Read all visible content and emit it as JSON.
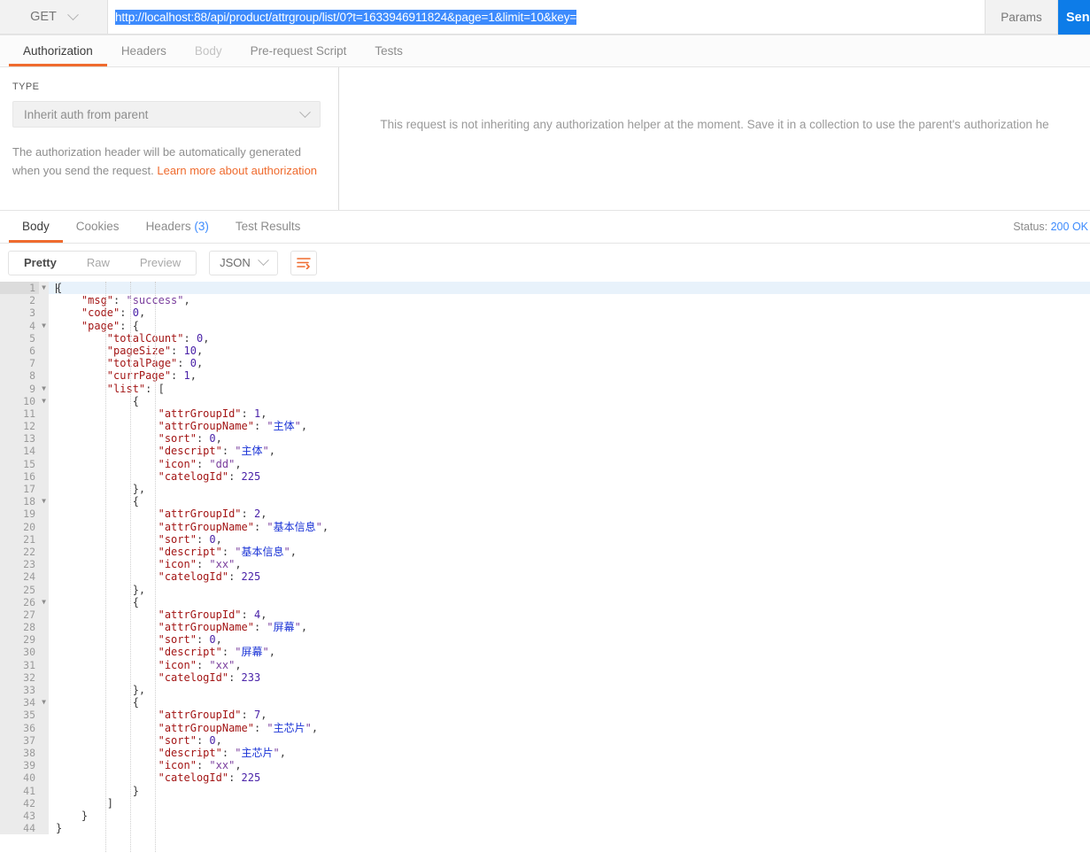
{
  "request": {
    "method": "GET",
    "url": "http://localhost:88/api/product/attrgroup/list/0?t=1633946911824&page=1&limit=10&key=",
    "params_label": "Params",
    "send_label": "Send",
    "tabs": [
      {
        "label": "Authorization",
        "state": "active"
      },
      {
        "label": "Headers",
        "state": "normal"
      },
      {
        "label": "Body",
        "state": "disabled"
      },
      {
        "label": "Pre-request Script",
        "state": "normal"
      },
      {
        "label": "Tests",
        "state": "normal"
      }
    ]
  },
  "auth": {
    "type_label": "TYPE",
    "type_value": "Inherit auth from parent",
    "description": "The authorization header will be automatically generated when you send the request.",
    "link_text": "Learn more about authorization",
    "inherit_message": "This request is not inheriting any authorization helper at the moment. Save it in a collection to use the parent's authorization he"
  },
  "response": {
    "tabs": [
      {
        "label": "Body",
        "state": "active",
        "count": ""
      },
      {
        "label": "Cookies",
        "state": "normal",
        "count": ""
      },
      {
        "label": "Headers",
        "state": "normal",
        "count": "(3)"
      },
      {
        "label": "Test Results",
        "state": "normal",
        "count": ""
      }
    ],
    "status_label": "Status:",
    "status_value": "200 OK",
    "view_modes": [
      {
        "label": "Pretty",
        "state": "active"
      },
      {
        "label": "Raw",
        "state": "normal"
      },
      {
        "label": "Preview",
        "state": "normal"
      }
    ],
    "format": "JSON",
    "wrap_icon": "word-wrap-icon"
  },
  "body_json": {
    "msg": "success",
    "code": 0,
    "page": {
      "totalCount": 0,
      "pageSize": 10,
      "totalPage": 0,
      "currPage": 1,
      "list": [
        {
          "attrGroupId": 1,
          "attrGroupName": "主体",
          "sort": 0,
          "descript": "主体",
          "icon": "dd",
          "catelogId": 225
        },
        {
          "attrGroupId": 2,
          "attrGroupName": "基本信息",
          "sort": 0,
          "descript": "基本信息",
          "icon": "xx",
          "catelogId": 225
        },
        {
          "attrGroupId": 4,
          "attrGroupName": "屏幕",
          "sort": 0,
          "descript": "屏幕",
          "icon": "xx",
          "catelogId": 233
        },
        {
          "attrGroupId": 7,
          "attrGroupName": "主芯片",
          "sort": 0,
          "descript": "主芯片",
          "icon": "xx",
          "catelogId": 225
        }
      ]
    }
  },
  "code_lines": [
    {
      "n": 1,
      "fold": true,
      "indent": 0,
      "tokens": [
        {
          "t": "p",
          "v": "{"
        }
      ],
      "caret": true,
      "highlight": true
    },
    {
      "n": 2,
      "fold": false,
      "indent": 1,
      "tokens": [
        {
          "t": "k",
          "v": "\"msg\""
        },
        {
          "t": "p",
          "v": ": "
        },
        {
          "t": "s",
          "v": "\"success\""
        },
        {
          "t": "p",
          "v": ","
        }
      ]
    },
    {
      "n": 3,
      "fold": false,
      "indent": 1,
      "tokens": [
        {
          "t": "k",
          "v": "\"code\""
        },
        {
          "t": "p",
          "v": ": "
        },
        {
          "t": "n",
          "v": "0"
        },
        {
          "t": "p",
          "v": ","
        }
      ]
    },
    {
      "n": 4,
      "fold": true,
      "indent": 1,
      "tokens": [
        {
          "t": "k",
          "v": "\"page\""
        },
        {
          "t": "p",
          "v": ": {"
        }
      ]
    },
    {
      "n": 5,
      "fold": false,
      "indent": 2,
      "tokens": [
        {
          "t": "k",
          "v": "\"totalCount\""
        },
        {
          "t": "p",
          "v": ": "
        },
        {
          "t": "n",
          "v": "0"
        },
        {
          "t": "p",
          "v": ","
        }
      ]
    },
    {
      "n": 6,
      "fold": false,
      "indent": 2,
      "tokens": [
        {
          "t": "k",
          "v": "\"pageSize\""
        },
        {
          "t": "p",
          "v": ": "
        },
        {
          "t": "n",
          "v": "10"
        },
        {
          "t": "p",
          "v": ","
        }
      ]
    },
    {
      "n": 7,
      "fold": false,
      "indent": 2,
      "tokens": [
        {
          "t": "k",
          "v": "\"totalPage\""
        },
        {
          "t": "p",
          "v": ": "
        },
        {
          "t": "n",
          "v": "0"
        },
        {
          "t": "p",
          "v": ","
        }
      ]
    },
    {
      "n": 8,
      "fold": false,
      "indent": 2,
      "tokens": [
        {
          "t": "k",
          "v": "\"currPage\""
        },
        {
          "t": "p",
          "v": ": "
        },
        {
          "t": "n",
          "v": "1"
        },
        {
          "t": "p",
          "v": ","
        }
      ]
    },
    {
      "n": 9,
      "fold": true,
      "indent": 2,
      "tokens": [
        {
          "t": "k",
          "v": "\"list\""
        },
        {
          "t": "p",
          "v": ": ["
        }
      ]
    },
    {
      "n": 10,
      "fold": true,
      "indent": 3,
      "tokens": [
        {
          "t": "p",
          "v": "{"
        }
      ]
    },
    {
      "n": 11,
      "fold": false,
      "indent": 4,
      "tokens": [
        {
          "t": "k",
          "v": "\"attrGroupId\""
        },
        {
          "t": "p",
          "v": ": "
        },
        {
          "t": "n",
          "v": "1"
        },
        {
          "t": "p",
          "v": ","
        }
      ]
    },
    {
      "n": 12,
      "fold": false,
      "indent": 4,
      "tokens": [
        {
          "t": "k",
          "v": "\"attrGroupName\""
        },
        {
          "t": "p",
          "v": ": "
        },
        {
          "t": "s",
          "v": "\""
        },
        {
          "t": "cn",
          "v": "主体"
        },
        {
          "t": "s",
          "v": "\""
        },
        {
          "t": "p",
          "v": ","
        }
      ]
    },
    {
      "n": 13,
      "fold": false,
      "indent": 4,
      "tokens": [
        {
          "t": "k",
          "v": "\"sort\""
        },
        {
          "t": "p",
          "v": ": "
        },
        {
          "t": "n",
          "v": "0"
        },
        {
          "t": "p",
          "v": ","
        }
      ]
    },
    {
      "n": 14,
      "fold": false,
      "indent": 4,
      "tokens": [
        {
          "t": "k",
          "v": "\"descript\""
        },
        {
          "t": "p",
          "v": ": "
        },
        {
          "t": "s",
          "v": "\""
        },
        {
          "t": "cn",
          "v": "主体"
        },
        {
          "t": "s",
          "v": "\""
        },
        {
          "t": "p",
          "v": ","
        }
      ]
    },
    {
      "n": 15,
      "fold": false,
      "indent": 4,
      "tokens": [
        {
          "t": "k",
          "v": "\"icon\""
        },
        {
          "t": "p",
          "v": ": "
        },
        {
          "t": "s",
          "v": "\"dd\""
        },
        {
          "t": "p",
          "v": ","
        }
      ]
    },
    {
      "n": 16,
      "fold": false,
      "indent": 4,
      "tokens": [
        {
          "t": "k",
          "v": "\"catelogId\""
        },
        {
          "t": "p",
          "v": ": "
        },
        {
          "t": "n",
          "v": "225"
        }
      ]
    },
    {
      "n": 17,
      "fold": false,
      "indent": 3,
      "tokens": [
        {
          "t": "p",
          "v": "},"
        }
      ]
    },
    {
      "n": 18,
      "fold": true,
      "indent": 3,
      "tokens": [
        {
          "t": "p",
          "v": "{"
        }
      ]
    },
    {
      "n": 19,
      "fold": false,
      "indent": 4,
      "tokens": [
        {
          "t": "k",
          "v": "\"attrGroupId\""
        },
        {
          "t": "p",
          "v": ": "
        },
        {
          "t": "n",
          "v": "2"
        },
        {
          "t": "p",
          "v": ","
        }
      ]
    },
    {
      "n": 20,
      "fold": false,
      "indent": 4,
      "tokens": [
        {
          "t": "k",
          "v": "\"attrGroupName\""
        },
        {
          "t": "p",
          "v": ": "
        },
        {
          "t": "s",
          "v": "\""
        },
        {
          "t": "cn",
          "v": "基本信息"
        },
        {
          "t": "s",
          "v": "\""
        },
        {
          "t": "p",
          "v": ","
        }
      ]
    },
    {
      "n": 21,
      "fold": false,
      "indent": 4,
      "tokens": [
        {
          "t": "k",
          "v": "\"sort\""
        },
        {
          "t": "p",
          "v": ": "
        },
        {
          "t": "n",
          "v": "0"
        },
        {
          "t": "p",
          "v": ","
        }
      ]
    },
    {
      "n": 22,
      "fold": false,
      "indent": 4,
      "tokens": [
        {
          "t": "k",
          "v": "\"descript\""
        },
        {
          "t": "p",
          "v": ": "
        },
        {
          "t": "s",
          "v": "\""
        },
        {
          "t": "cn",
          "v": "基本信息"
        },
        {
          "t": "s",
          "v": "\""
        },
        {
          "t": "p",
          "v": ","
        }
      ]
    },
    {
      "n": 23,
      "fold": false,
      "indent": 4,
      "tokens": [
        {
          "t": "k",
          "v": "\"icon\""
        },
        {
          "t": "p",
          "v": ": "
        },
        {
          "t": "s",
          "v": "\"xx\""
        },
        {
          "t": "p",
          "v": ","
        }
      ]
    },
    {
      "n": 24,
      "fold": false,
      "indent": 4,
      "tokens": [
        {
          "t": "k",
          "v": "\"catelogId\""
        },
        {
          "t": "p",
          "v": ": "
        },
        {
          "t": "n",
          "v": "225"
        }
      ]
    },
    {
      "n": 25,
      "fold": false,
      "indent": 3,
      "tokens": [
        {
          "t": "p",
          "v": "},"
        }
      ]
    },
    {
      "n": 26,
      "fold": true,
      "indent": 3,
      "tokens": [
        {
          "t": "p",
          "v": "{"
        }
      ]
    },
    {
      "n": 27,
      "fold": false,
      "indent": 4,
      "tokens": [
        {
          "t": "k",
          "v": "\"attrGroupId\""
        },
        {
          "t": "p",
          "v": ": "
        },
        {
          "t": "n",
          "v": "4"
        },
        {
          "t": "p",
          "v": ","
        }
      ]
    },
    {
      "n": 28,
      "fold": false,
      "indent": 4,
      "tokens": [
        {
          "t": "k",
          "v": "\"attrGroupName\""
        },
        {
          "t": "p",
          "v": ": "
        },
        {
          "t": "s",
          "v": "\""
        },
        {
          "t": "cn",
          "v": "屏幕"
        },
        {
          "t": "s",
          "v": "\""
        },
        {
          "t": "p",
          "v": ","
        }
      ]
    },
    {
      "n": 29,
      "fold": false,
      "indent": 4,
      "tokens": [
        {
          "t": "k",
          "v": "\"sort\""
        },
        {
          "t": "p",
          "v": ": "
        },
        {
          "t": "n",
          "v": "0"
        },
        {
          "t": "p",
          "v": ","
        }
      ]
    },
    {
      "n": 30,
      "fold": false,
      "indent": 4,
      "tokens": [
        {
          "t": "k",
          "v": "\"descript\""
        },
        {
          "t": "p",
          "v": ": "
        },
        {
          "t": "s",
          "v": "\""
        },
        {
          "t": "cn",
          "v": "屏幕"
        },
        {
          "t": "s",
          "v": "\""
        },
        {
          "t": "p",
          "v": ","
        }
      ]
    },
    {
      "n": 31,
      "fold": false,
      "indent": 4,
      "tokens": [
        {
          "t": "k",
          "v": "\"icon\""
        },
        {
          "t": "p",
          "v": ": "
        },
        {
          "t": "s",
          "v": "\"xx\""
        },
        {
          "t": "p",
          "v": ","
        }
      ]
    },
    {
      "n": 32,
      "fold": false,
      "indent": 4,
      "tokens": [
        {
          "t": "k",
          "v": "\"catelogId\""
        },
        {
          "t": "p",
          "v": ": "
        },
        {
          "t": "n",
          "v": "233"
        }
      ]
    },
    {
      "n": 33,
      "fold": false,
      "indent": 3,
      "tokens": [
        {
          "t": "p",
          "v": "},"
        }
      ]
    },
    {
      "n": 34,
      "fold": true,
      "indent": 3,
      "tokens": [
        {
          "t": "p",
          "v": "{"
        }
      ]
    },
    {
      "n": 35,
      "fold": false,
      "indent": 4,
      "tokens": [
        {
          "t": "k",
          "v": "\"attrGroupId\""
        },
        {
          "t": "p",
          "v": ": "
        },
        {
          "t": "n",
          "v": "7"
        },
        {
          "t": "p",
          "v": ","
        }
      ]
    },
    {
      "n": 36,
      "fold": false,
      "indent": 4,
      "tokens": [
        {
          "t": "k",
          "v": "\"attrGroupName\""
        },
        {
          "t": "p",
          "v": ": "
        },
        {
          "t": "s",
          "v": "\""
        },
        {
          "t": "cn",
          "v": "主芯片"
        },
        {
          "t": "s",
          "v": "\""
        },
        {
          "t": "p",
          "v": ","
        }
      ]
    },
    {
      "n": 37,
      "fold": false,
      "indent": 4,
      "tokens": [
        {
          "t": "k",
          "v": "\"sort\""
        },
        {
          "t": "p",
          "v": ": "
        },
        {
          "t": "n",
          "v": "0"
        },
        {
          "t": "p",
          "v": ","
        }
      ]
    },
    {
      "n": 38,
      "fold": false,
      "indent": 4,
      "tokens": [
        {
          "t": "k",
          "v": "\"descript\""
        },
        {
          "t": "p",
          "v": ": "
        },
        {
          "t": "s",
          "v": "\""
        },
        {
          "t": "cn",
          "v": "主芯片"
        },
        {
          "t": "s",
          "v": "\""
        },
        {
          "t": "p",
          "v": ","
        }
      ]
    },
    {
      "n": 39,
      "fold": false,
      "indent": 4,
      "tokens": [
        {
          "t": "k",
          "v": "\"icon\""
        },
        {
          "t": "p",
          "v": ": "
        },
        {
          "t": "s",
          "v": "\"xx\""
        },
        {
          "t": "p",
          "v": ","
        }
      ]
    },
    {
      "n": 40,
      "fold": false,
      "indent": 4,
      "tokens": [
        {
          "t": "k",
          "v": "\"catelogId\""
        },
        {
          "t": "p",
          "v": ": "
        },
        {
          "t": "n",
          "v": "225"
        }
      ]
    },
    {
      "n": 41,
      "fold": false,
      "indent": 3,
      "tokens": [
        {
          "t": "p",
          "v": "}"
        }
      ]
    },
    {
      "n": 42,
      "fold": false,
      "indent": 2,
      "tokens": [
        {
          "t": "p",
          "v": "]"
        }
      ]
    },
    {
      "n": 43,
      "fold": false,
      "indent": 1,
      "tokens": [
        {
          "t": "p",
          "v": "}"
        }
      ]
    },
    {
      "n": 44,
      "fold": false,
      "indent": 0,
      "tokens": [
        {
          "t": "p",
          "v": "}"
        }
      ]
    }
  ],
  "colors": {
    "accent_orange": "#ef6b2e",
    "accent_blue": "#3d8bfd",
    "send_blue": "#0d7ce8",
    "selection_blue": "#3d8bfd"
  }
}
